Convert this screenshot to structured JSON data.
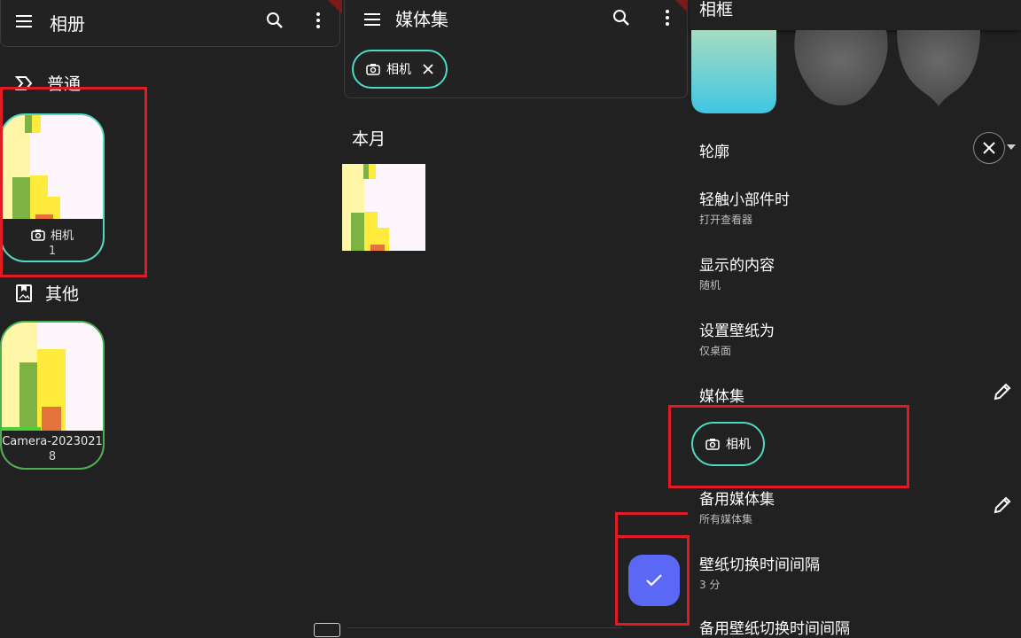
{
  "left": {
    "title": "相册",
    "sections": [
      {
        "title": "普通",
        "albums": [
          {
            "name": "相机",
            "count": "1"
          }
        ]
      },
      {
        "title": "其他",
        "albums": [
          {
            "name": "Camera-2023021",
            "count": "8"
          }
        ]
      }
    ]
  },
  "middle": {
    "title": "媒体集",
    "chip": {
      "label": "相机"
    },
    "section": "本月"
  },
  "right": {
    "header": "相框",
    "settings": [
      {
        "title": "轮廓",
        "subtitle": ""
      },
      {
        "title": "轻触小部件时",
        "subtitle": "打开查看器"
      },
      {
        "title": "显示的内容",
        "subtitle": "随机"
      },
      {
        "title": "设置壁纸为",
        "subtitle": "仅桌面"
      },
      {
        "title": "媒体集",
        "subtitle": ""
      },
      {
        "title": "备用媒体集",
        "subtitle": "所有媒体集"
      },
      {
        "title": "壁纸切换时间间隔",
        "subtitle": "3 分"
      },
      {
        "title": "备用壁纸切换时间间隔",
        "subtitle": ""
      }
    ],
    "collection_chip": {
      "label": "相机"
    }
  },
  "icons": {
    "menu": "menu-icon",
    "search": "search-icon",
    "more": "more-vert-icon",
    "camera": "camera-icon",
    "close": "close-icon",
    "edit": "pencil-icon",
    "check": "check-icon"
  },
  "colors": {
    "accent_teal": "#4fd8c4",
    "fab": "#5b67f5",
    "highlight_red": "#e01b24"
  }
}
